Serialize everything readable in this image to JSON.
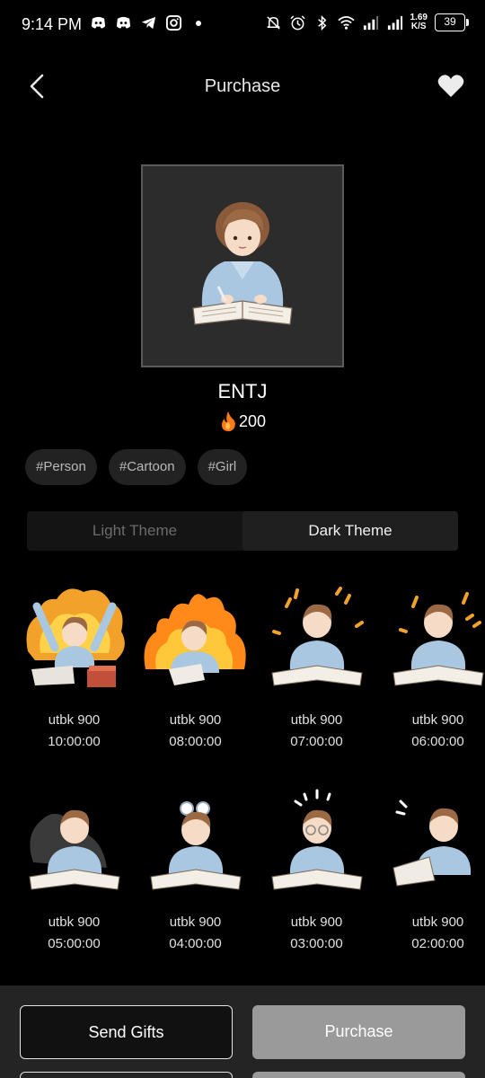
{
  "status_bar": {
    "time": "9:14 PM",
    "network_speed_value": "1.69",
    "network_speed_unit": "K/S",
    "battery": "39"
  },
  "header": {
    "title": "Purchase"
  },
  "product": {
    "name": "ENTJ",
    "price": "200",
    "tags": [
      "#Person",
      "#Cartoon",
      "#Girl"
    ]
  },
  "theme_toggle": {
    "light": "Light Theme",
    "dark": "Dark Theme",
    "selected": "dark"
  },
  "stickers": [
    {
      "label": "utbk 900",
      "time": "10:00:00"
    },
    {
      "label": "utbk 900",
      "time": "08:00:00"
    },
    {
      "label": "utbk 900",
      "time": "07:00:00"
    },
    {
      "label": "utbk 900",
      "time": "06:00:00"
    },
    {
      "label": "utbk 900",
      "time": "05:00:00"
    },
    {
      "label": "utbk 900",
      "time": "04:00:00"
    },
    {
      "label": "utbk 900",
      "time": "03:00:00"
    },
    {
      "label": "utbk 900",
      "time": "02:00:00"
    }
  ],
  "actions": {
    "send_gifts": "Send Gifts",
    "purchase": "Purchase"
  },
  "colors": {
    "background": "#000000",
    "panel": "#242424",
    "purchase_button": "#9a9a9a",
    "fire": "#ff7a1a"
  }
}
